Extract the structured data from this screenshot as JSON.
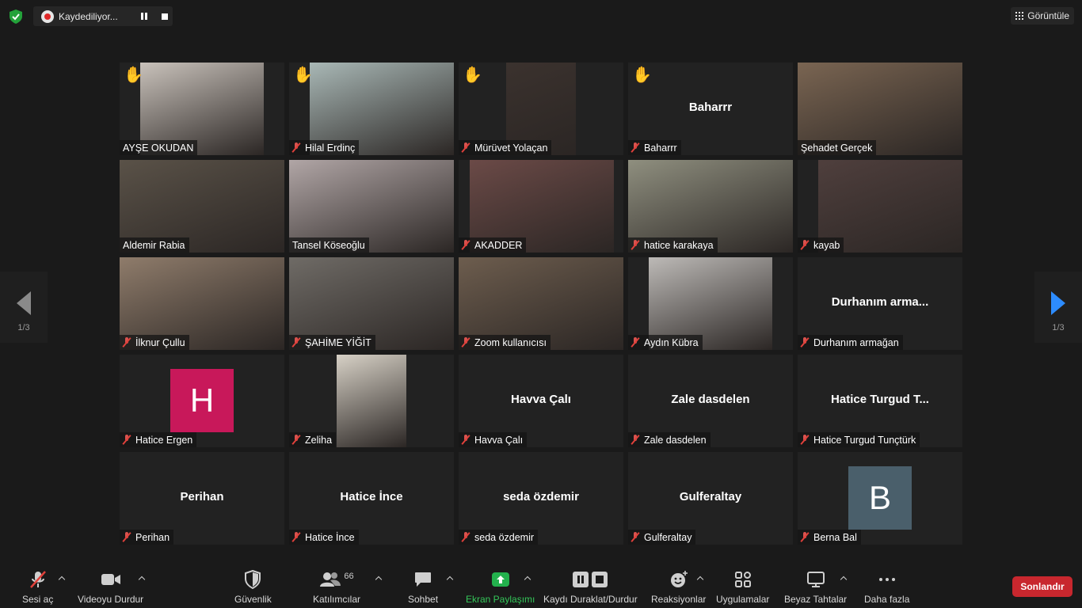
{
  "top": {
    "recording_text": "Kaydediliyor...",
    "view_label": "Görüntüle"
  },
  "nav": {
    "left_page": "1/3",
    "right_page": "1/3"
  },
  "tiles": [
    {
      "name": "AYŞE OKUDAN",
      "muted": false,
      "hand": true,
      "video": true,
      "big": "",
      "avatar": "",
      "bg": "#c9c2bb"
    },
    {
      "name": "Hilal Erdinç",
      "muted": true,
      "hand": true,
      "video": true,
      "big": "",
      "avatar": "",
      "bg": "#a9b8b6"
    },
    {
      "name": "Mürüvet Yolaçan",
      "muted": true,
      "hand": true,
      "video": true,
      "big": "",
      "avatar": "",
      "bg": "#3b322e"
    },
    {
      "name": "Baharrr",
      "muted": true,
      "hand": true,
      "video": false,
      "big": "Baharrr",
      "avatar": "",
      "bg": ""
    },
    {
      "name": "Şehadet Gerçek",
      "muted": false,
      "hand": false,
      "video": true,
      "big": "",
      "avatar": "",
      "bg": "#7a6552"
    },
    {
      "name": "Aldemir Rabia",
      "muted": false,
      "hand": false,
      "video": true,
      "big": "",
      "avatar": "",
      "bg": "#5a5248"
    },
    {
      "name": "Tansel Köseoğlu",
      "muted": false,
      "hand": false,
      "video": true,
      "big": "",
      "avatar": "",
      "bg": "#b1a6a6",
      "active": true
    },
    {
      "name": "AKADDER",
      "muted": true,
      "hand": false,
      "video": true,
      "big": "",
      "avatar": "",
      "bg": "#6b4a47"
    },
    {
      "name": "hatice karakaya",
      "muted": true,
      "hand": false,
      "video": true,
      "big": "",
      "avatar": "",
      "bg": "#8f8f7f"
    },
    {
      "name": "kayab",
      "muted": true,
      "hand": false,
      "video": true,
      "big": "",
      "avatar": "",
      "bg": "#4f3f3d"
    },
    {
      "name": "İlknur Çullu",
      "muted": true,
      "hand": false,
      "video": true,
      "big": "",
      "avatar": "",
      "bg": "#8f7c6b"
    },
    {
      "name": "ŞAHİME YİĞİT",
      "muted": true,
      "hand": false,
      "video": true,
      "big": "",
      "avatar": "",
      "bg": "#6f6b66"
    },
    {
      "name": "Zoom kullanıcısı",
      "muted": true,
      "hand": false,
      "video": true,
      "big": "",
      "avatar": "",
      "bg": "#6d5d4e"
    },
    {
      "name": "Aydın Kübra",
      "muted": true,
      "hand": false,
      "video": true,
      "big": "",
      "avatar": "",
      "bg": "#bdbab7"
    },
    {
      "name": "Durhanım armağan",
      "muted": true,
      "hand": false,
      "video": false,
      "big": "Durhanım arma...",
      "avatar": "",
      "bg": ""
    },
    {
      "name": "Hatice Ergen",
      "muted": true,
      "hand": false,
      "video": false,
      "big": "",
      "avatar": "H",
      "bg": "#c8185a"
    },
    {
      "name": "Zeliha",
      "muted": true,
      "hand": false,
      "video": true,
      "big": "",
      "avatar": "",
      "bg": "#d7d1c6"
    },
    {
      "name": "Havva Çalı",
      "muted": true,
      "hand": false,
      "video": false,
      "big": "Havva Çalı",
      "avatar": "",
      "bg": ""
    },
    {
      "name": "Zale dasdelen",
      "muted": true,
      "hand": false,
      "video": false,
      "big": "Zale dasdelen",
      "avatar": "",
      "bg": ""
    },
    {
      "name": "Hatice Turgud Tunçtürk",
      "muted": true,
      "hand": false,
      "video": false,
      "big": "Hatice Turgud T...",
      "avatar": "",
      "bg": ""
    },
    {
      "name": "Perihan",
      "muted": true,
      "hand": false,
      "video": false,
      "big": "Perihan",
      "avatar": "",
      "bg": ""
    },
    {
      "name": "Hatice İnce",
      "muted": true,
      "hand": false,
      "video": false,
      "big": "Hatice İnce",
      "avatar": "",
      "bg": ""
    },
    {
      "name": "seda özdemir",
      "muted": true,
      "hand": false,
      "video": false,
      "big": "seda özdemir",
      "avatar": "",
      "bg": ""
    },
    {
      "name": "Gulferaltay",
      "muted": true,
      "hand": false,
      "video": false,
      "big": "Gulferaltay",
      "avatar": "",
      "bg": ""
    },
    {
      "name": "Berna Bal",
      "muted": true,
      "hand": false,
      "video": false,
      "big": "",
      "avatar": "B",
      "bg": "#4a5f6b"
    }
  ],
  "toolbar": {
    "unmute": "Sesi aç",
    "stop_video": "Videoyu Durdur",
    "security": "Güvenlik",
    "participants": "Katılımcılar",
    "participants_count": "66",
    "chat": "Sohbet",
    "share": "Ekran Paylaşımı",
    "record": "Kaydı Duraklat/Durdur",
    "reactions": "Reaksiyonlar",
    "apps": "Uygulamalar",
    "whiteboards": "Beyaz Tahtalar",
    "more": "Daha fazla",
    "end": "Sonlandır"
  }
}
